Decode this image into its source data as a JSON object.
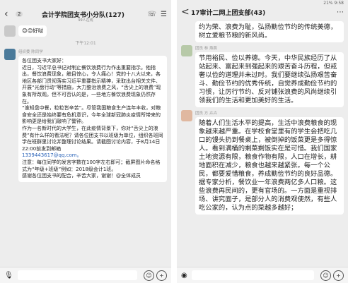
{
  "left": {
    "title": "会计学院团支书小分队(127)",
    "badge": "2",
    "subtitle": "99人在线",
    "emoji_msg": "😊😊好哒",
    "time": "下午12:01",
    "sender_tag": "组织委 陈同学",
    "message_lines": [
      "各位团支书大家好：",
      "近日，习近平总书记对制止餐饮浪费行为作出重要指示。他指出，餐饮浪费现象，触目惊心，令人痛心！党的十八大以来，各地区各部门贯彻落实习近平重要指示精神，采取出台相关文件、开展“光盘行动”等措施，大力整治浪费之风，“舌尖上的浪费”现象有所改观。但不可否认的是，一些地方餐饮浪费现象仍然存在。",
      "“谁知盘中餐，粒粒皆辛苦”。尽管我国粮食生产连年丰收，对粮食安全还是始终要有危机意识，今年全球新冠肺炎疫情所带来的影响更是给我们敲响了警钟。",
      "作为一名新时代的大学生，在此疫情背景下，你对“舌尖上的浪费”有什么样的看法呢？请各位团支书以班级为单位，组织各班同学在班群里讨论并整理讨论结果。请截图讨论内容，于8月14日22:00前发到邮箱",
      "1339443617@qq.com。",
      "注意：每位同学的发言字数在100字左右即可；截屏图片命名格式为“年级+班级”例如：2018级会计1班。",
      "感谢各位团支书的配合，辛苦大家，谢谢！@全体成员"
    ],
    "input_placeholder": ""
  },
  "right": {
    "title": "17审计二网上团支部(43)",
    "back_label": "<",
    "status_time": "9:58",
    "status_battery": "21%",
    "msg1_tail": "约为荣、浪费为耻，弘扬勤俭节约的传统美德，树立爱粮节粮的新风尚。",
    "msg2_tag": "团员 林 燕燕",
    "msg2": "节用裕民、俭以养德。今天，中华民族经历了从站起来、富起来到强起来的艰苦奋斗历程，但戒奢以俭的道理并未过时。我们要继续弘扬艰苦奋斗、勤俭节约的优秀传统，自觉养成勤俭节约的习惯，让厉行节约、反对铺张浪费的风尚继续引领我们的生活和更加美好的生活。",
    "msg3_tag": "团员 方 卉卉",
    "msg3": "随着人们生活水平的提高，生活中浪费粮食的现象越来越严重。在学校食堂里有的学生会把吃几口的馒头扔到餐桌上，被倒掉的饭菜更是多得惊人。看到满桶的剩菜剩饭实在是可惜。我们国家土地资源有限，粮食作物有限，人口在增长，耕地面积在减少，粮食也越来越紧张。每一个公民，都要爱惜粮食，养成勤俭节约的良好品德。据专家分析，餐饮业一年浪费两亿多人口粮。这些浪费再民间的，更有官场的。一方面是重视排场、讲究面子，是部分人的消费观使然，有些人吃公家的，认为点的菜越多越好；"
  }
}
